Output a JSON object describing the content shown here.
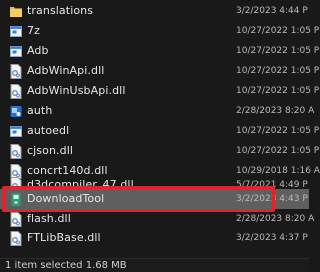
{
  "files": [
    {
      "name": "translations",
      "date": "3/2/2023 4:44 P",
      "icon": "folder-icon"
    },
    {
      "name": "7z",
      "date": "10/27/2022 1:05 P",
      "icon": "application-icon"
    },
    {
      "name": "Adb",
      "date": "10/27/2022 1:05 P",
      "icon": "application-icon"
    },
    {
      "name": "AdbWinApi.dll",
      "date": "10/27/2022 1:05 P",
      "icon": "dll-file-icon"
    },
    {
      "name": "AdbWinUsbApi.dll",
      "date": "10/27/2022 1:05 P",
      "icon": "dll-file-icon"
    },
    {
      "name": "auth",
      "date": "2/28/2023 8:20 A",
      "icon": "auth-app-icon"
    },
    {
      "name": "autoedl",
      "date": "10/27/2022 1:05 P",
      "icon": "application-icon"
    },
    {
      "name": "cjson.dll",
      "date": "10/27/2022 1:05 P",
      "icon": "dll-file-icon"
    },
    {
      "name": "concrt140d.dll",
      "date": "10/29/2018 1:16 A",
      "icon": "dll-file-icon"
    },
    {
      "name": "d3dcompiler_47.dll",
      "date": "5/7/2021 4:49 P",
      "icon": "dll-file-icon"
    },
    {
      "name": "DownloadTool",
      "date": "3/2/2023 4:43 P",
      "icon": "download-tool-icon",
      "selected": true
    },
    {
      "name": "flash.dll",
      "date": "2/28/2023 8:20 A",
      "icon": "dll-file-icon"
    },
    {
      "name": "FTLibBase.dll",
      "date": "3/2/2023 4:37 P",
      "icon": "dll-file-icon"
    }
  ],
  "status_bar": {
    "text": "1 item selected  1.68 MB"
  },
  "colors": {
    "selection": "#5f5f5f",
    "highlight_border": "#e3222d",
    "folder": "#e8b94a"
  }
}
